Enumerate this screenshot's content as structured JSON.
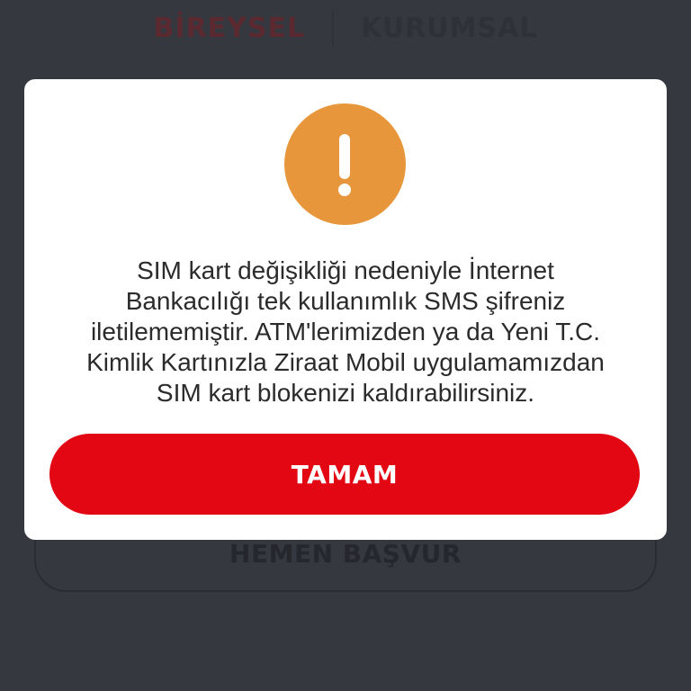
{
  "background": {
    "segment": {
      "individual_label": "BİREYSEL",
      "corporate_label": "KURUMSAL"
    },
    "apply_button_label": "HEMEN BAŞVUR"
  },
  "dialog": {
    "icon": "exclamation-warning-icon",
    "message_lines": [
      "SIM kart değişikliği nedeniyle İnternet",
      "Bankacılığı tek kullanımlık SMS şifreniz",
      "iletilememiştir. ATM'lerimizden ya da Yeni T.C.",
      "Kimlik Kartınızla Ziraat Mobil uygulamamızdan",
      "SIM kart blokenizi kaldırabilirsiniz."
    ],
    "ok_label": "TAMAM"
  },
  "colors": {
    "overlay_background": "#363840",
    "warning_orange": "#e8963b",
    "primary_red": "#e30613",
    "dialog_background": "#ffffff"
  }
}
